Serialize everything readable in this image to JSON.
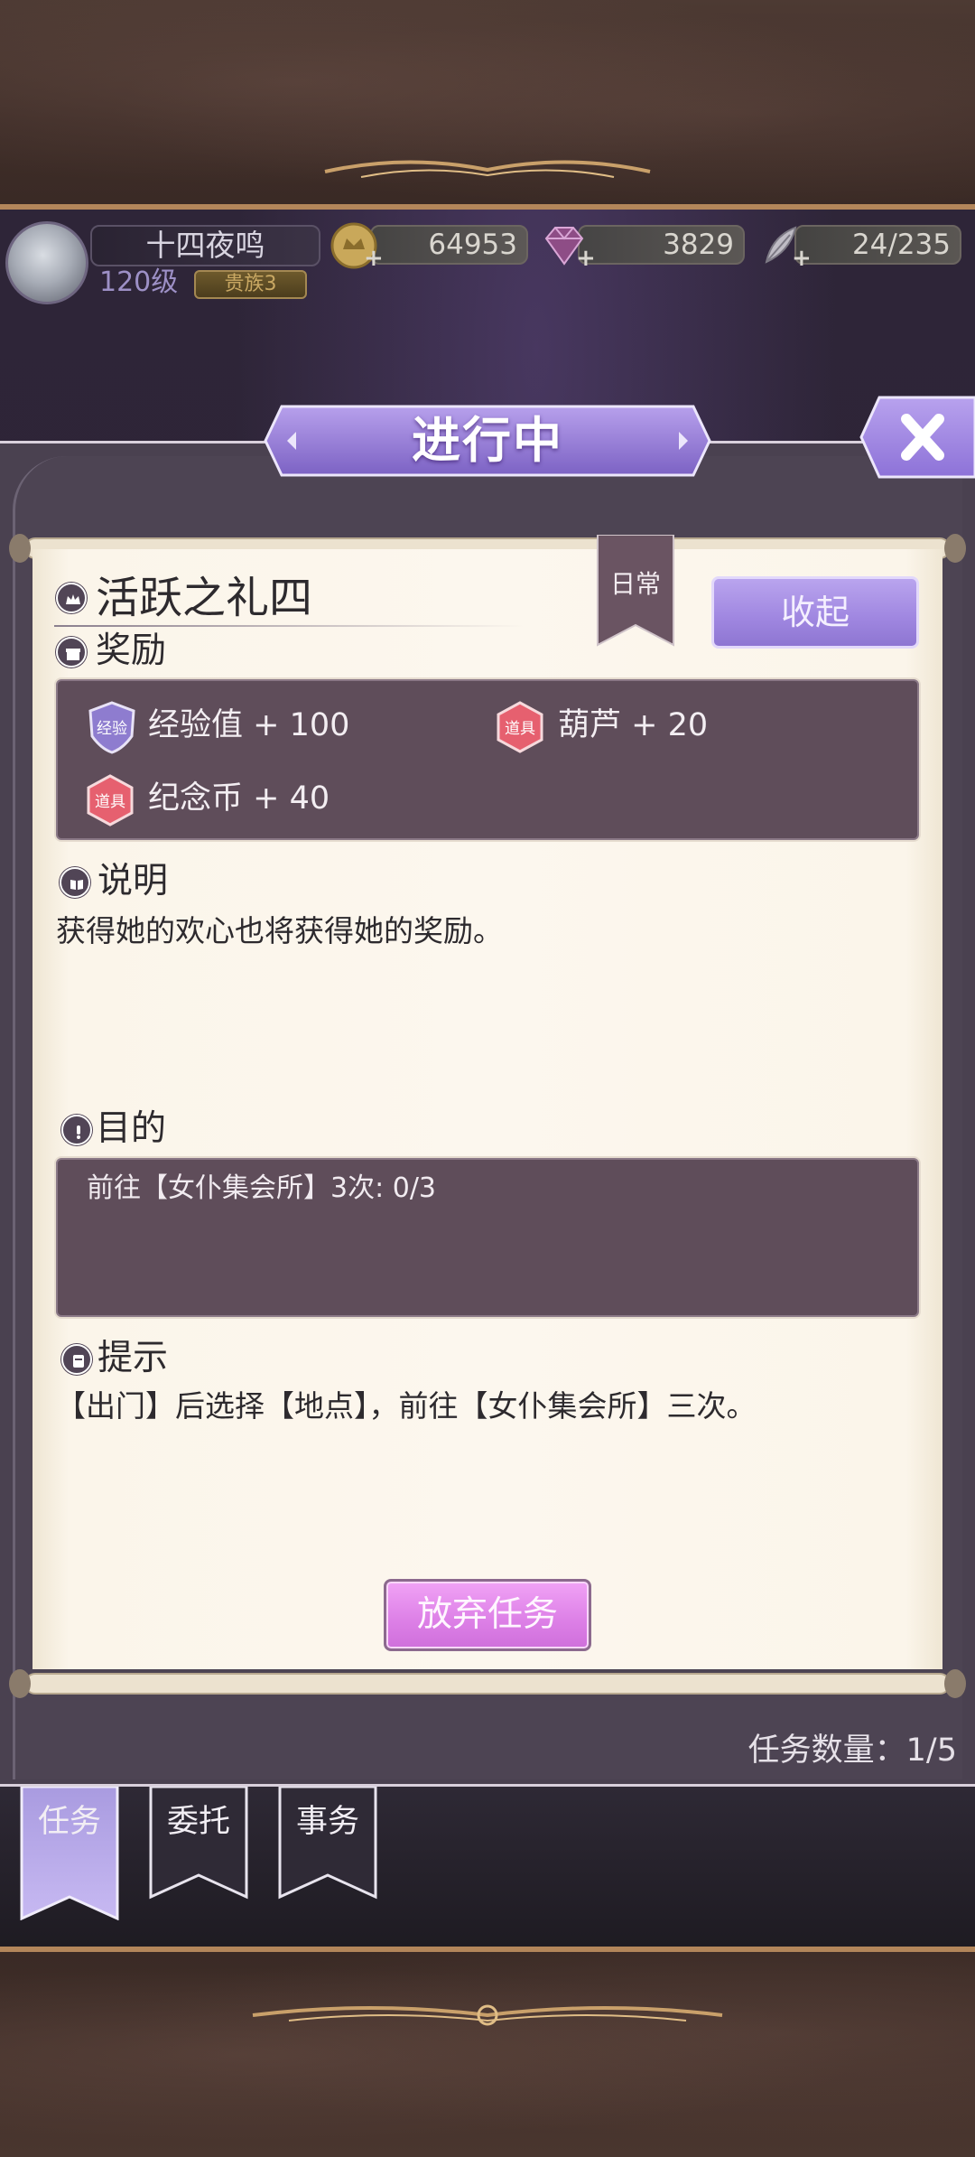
{
  "player": {
    "name": "十四夜鸣",
    "level": "120级",
    "rank": "贵族3"
  },
  "resources": {
    "gold": "64953",
    "gems": "3829",
    "stamina": "24/235"
  },
  "dialog": {
    "title": "进行中",
    "close_label": "X"
  },
  "quest": {
    "tag": "日常",
    "name": "活跃之礼四",
    "collapse_label": "收起",
    "rewards_heading": "奖励",
    "rewards": [
      {
        "badge": "经验",
        "text": "经验值 + 100"
      },
      {
        "badge": "道具",
        "text": "葫芦 + 20"
      },
      {
        "badge": "道具",
        "text": "纪念币 + 40"
      }
    ],
    "description_heading": "说明",
    "description": "获得她的欢心也将获得她的奖励。",
    "objective_heading": "目的",
    "objective": "前往【女仆集会所】3次: 0/3",
    "hint_heading": "提示",
    "hint": "【出门】后选择【地点】，前往【女仆集会所】三次。",
    "abandon_label": "放弃任务"
  },
  "quest_count": "任务数量：1/5",
  "tabs": [
    {
      "label": "任务",
      "active": true
    },
    {
      "label": "委托",
      "active": false
    },
    {
      "label": "事务",
      "active": false
    }
  ],
  "colors": {
    "accent_purple": "#9f86e0",
    "abandon_pink": "#dc7fe6",
    "panel_bg": "#4a4150",
    "paper": "#fcf7ee",
    "reward_box": "#5f4d5a"
  }
}
